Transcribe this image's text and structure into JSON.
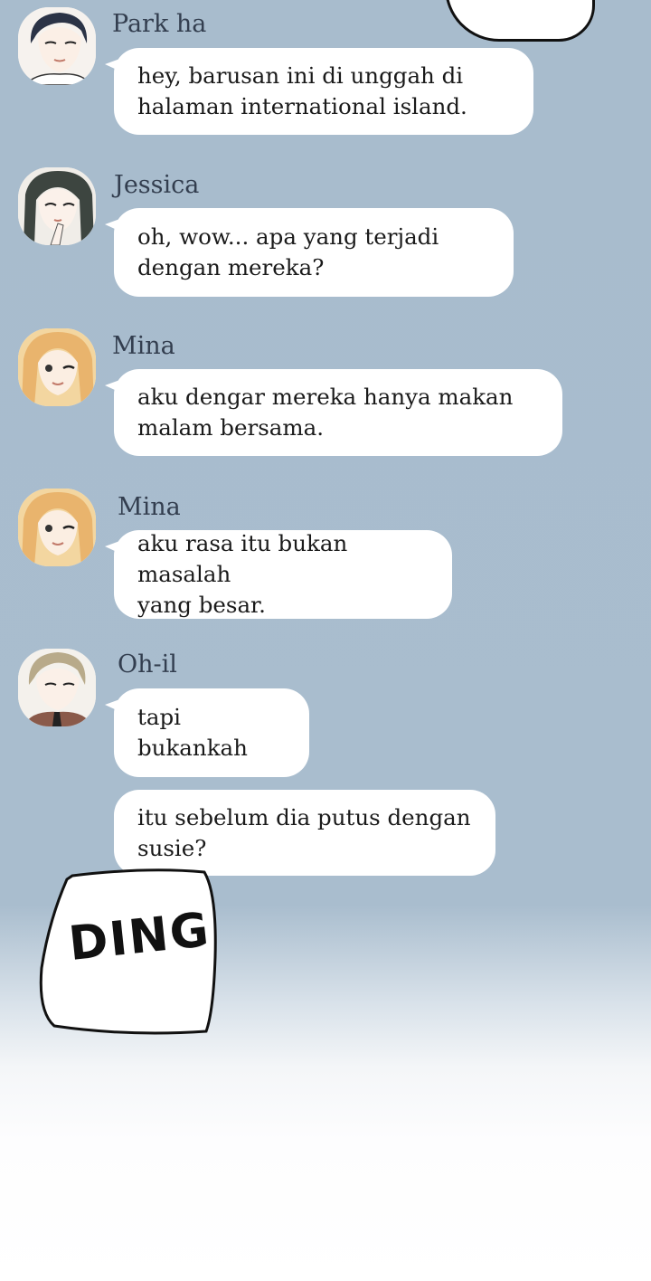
{
  "messages": [
    {
      "sender": "Park ha",
      "avatar": "park-ha-avatar",
      "text": "hey, barusan ini di unggah di\nhalaman international island."
    },
    {
      "sender": "Jessica",
      "avatar": "jessica-avatar",
      "text": "oh, wow... apa yang terjadi\ndengan mereka?"
    },
    {
      "sender": "Mina",
      "avatar": "mina-avatar",
      "text": "aku dengar mereka hanya makan\nmalam bersama."
    },
    {
      "sender": "Mina",
      "avatar": "mina-avatar",
      "text": "aku rasa itu bukan masalah\nyang besar."
    },
    {
      "sender": "Oh-il",
      "avatar": "oh-il-avatar",
      "text": "tapi bukankah"
    },
    {
      "sender": "Oh-il",
      "avatar": "",
      "text": "itu sebelum dia putus dengan\nsusie?"
    }
  ],
  "sound_effect": "DING",
  "colors": {
    "background": "#a9bdce",
    "bubble": "#ffffff",
    "name_text": "#333e4f",
    "message_text": "#1a1a1a"
  }
}
